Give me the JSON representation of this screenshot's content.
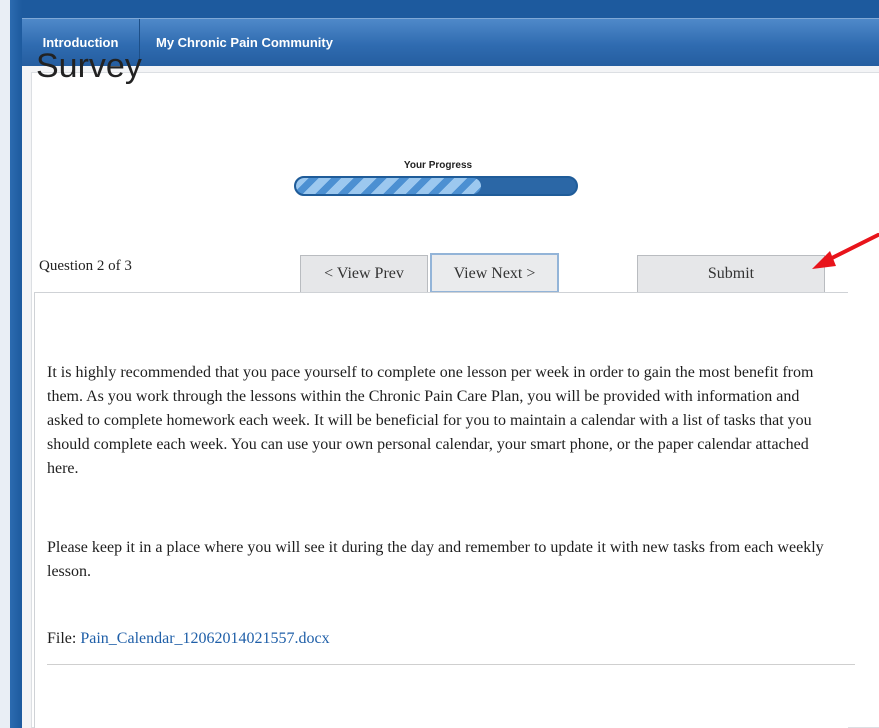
{
  "nav": {
    "tabs": [
      "Introduction",
      "My Chronic Pain Community"
    ]
  },
  "survey": {
    "title": "Survey",
    "progress_label": "Your Progress",
    "progress_fraction": 0.66,
    "question_label": "Question  2 of 3",
    "prev_label": "< View Prev",
    "next_label": "View Next >",
    "submit_label": "Submit"
  },
  "content": {
    "paragraph1": "It is highly recommended that you pace yourself to complete one lesson per week in order to gain the most benefit from them. As you work through the lessons within the Chronic Pain Care Plan, you will be provided with information and asked to complete homework each week.  It will be beneficial for you to maintain a calendar with a list of tasks that you should complete each week.  You can use your own personal calendar, your smart phone, or the paper calendar attached here.",
    "paragraph2": "Please keep it in a place where you will see it during the day and remember to update it with new tasks from each weekly lesson.",
    "file_label": "File: ",
    "file_name": "Pain_Calendar_12062014021557.docx"
  },
  "colors": {
    "nav_bar": "#2f6bb0",
    "link": "#1f5fa8",
    "annotation_arrow": "#e8141b"
  },
  "annotation": {
    "icon": "red-arrow-icon"
  }
}
